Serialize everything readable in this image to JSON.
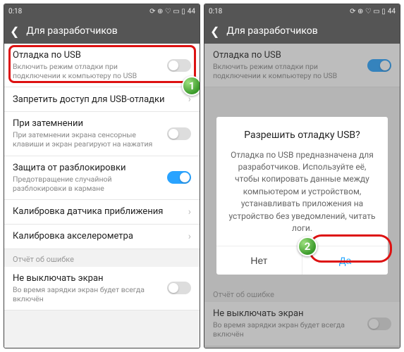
{
  "status": {
    "time": "0:18",
    "battery": "44"
  },
  "header": {
    "title": "Для разработчиков"
  },
  "rows": {
    "usb_debug": {
      "title": "Отладка по USB",
      "sub": "Включить режим отладки при подключении к компьютеру по USB"
    },
    "deny_usb": {
      "title": "Запретить доступ для USB-отладки"
    },
    "dim": {
      "title": "При затемнении",
      "sub": "При затемнении экрана сенсорные клавиши и экран реагируют на нажатия"
    },
    "unlock_guard": {
      "title": "Защита от разблокировки",
      "sub": "Предотвращение случайной разблокировки в кармане"
    },
    "prox_cal": {
      "title": "Калибровка датчика приближения"
    },
    "accel_cal": {
      "title": "Калибровка акселерометра"
    },
    "section_error": "Отчёт об ошибке",
    "screen_on": {
      "title": "Не выключать экран",
      "sub": "Во время зарядки экран будет всегда включён"
    }
  },
  "dialog": {
    "title": "Разрешить отладку USB?",
    "body": "Отладка по USB предназначена для разработчиков. Используйте её, чтобы копировать данные между компьютером и устройством, устанавливать приложения на устройство без уведомлений, читать логи.",
    "no": "Нет",
    "yes": "Да"
  },
  "badges": {
    "one": "1",
    "two": "2"
  }
}
